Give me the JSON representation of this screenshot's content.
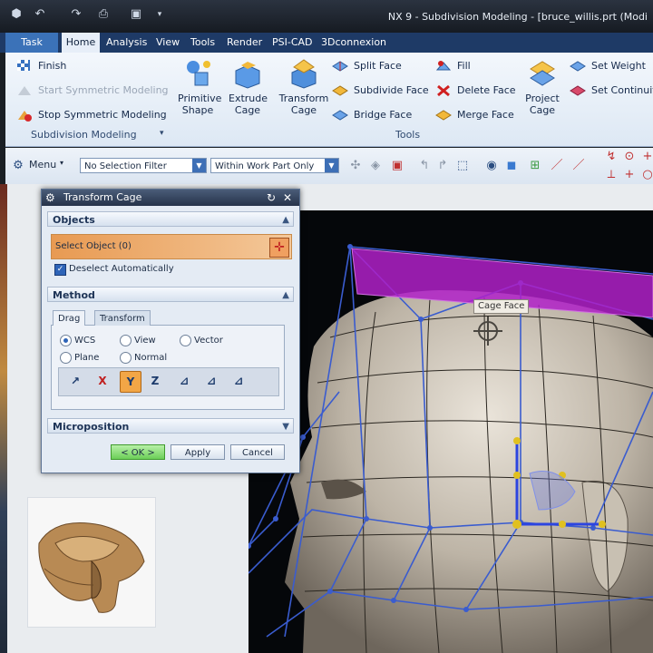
{
  "window": {
    "title": "NX 9 - Subdivision Modeling - [bruce_willis.prt (Modi"
  },
  "tabs": [
    "Task",
    "Home",
    "Analysis",
    "View",
    "Tools",
    "Render",
    "PSI-CAD",
    "3Dconnexion"
  ],
  "ribbon": {
    "subdivision": {
      "finish": "Finish",
      "start_symmetric": "Start Symmetric Modeling",
      "stop_symmetric": "Stop Symmetric Modeling",
      "group_label": "Subdivision Modeling"
    },
    "big": {
      "primitive": "Primitive Shape",
      "extrude": "Extrude Cage",
      "transform": "Transform Cage",
      "project": "Project Cage"
    },
    "tools": {
      "split_face": "Split Face",
      "subdivide_face": "Subdivide Face",
      "bridge_face": "Bridge Face",
      "fill": "Fill",
      "delete_face": "Delete Face",
      "merge_face": "Merge Face",
      "group_label": "Tools"
    },
    "weights": {
      "set_weight": "Set Weight",
      "set_continuity": "Set Continuit"
    }
  },
  "toolbar": {
    "menu_label": "Menu",
    "selection_filter": "No Selection Filter",
    "scope_filter": "Within Work Part Only"
  },
  "dialog": {
    "title": "Transform Cage",
    "objects_section": "Objects",
    "select_object": "Select Object (0)",
    "deselect_auto": "Deselect Automatically",
    "method_section": "Method",
    "tab_drag": "Drag",
    "tab_transform": "Transform",
    "radios": {
      "wcs": "WCS",
      "view": "View",
      "vector": "Vector",
      "plane": "Plane",
      "normal": "Normal"
    },
    "axis_labels": {
      "x": "X",
      "y": "Y",
      "z": "Z"
    },
    "microposition": "Microposition",
    "ok": "< OK >",
    "apply": "Apply",
    "cancel": "Cancel"
  },
  "viewport": {
    "tooltip": "Cage Face"
  },
  "colors": {
    "accent": "#3b72b8",
    "selection_face": "#b020c8",
    "cage_lines": "#3a5ccf",
    "ok_button": "#7fdc6a",
    "highlight_row": "#e8a860"
  }
}
